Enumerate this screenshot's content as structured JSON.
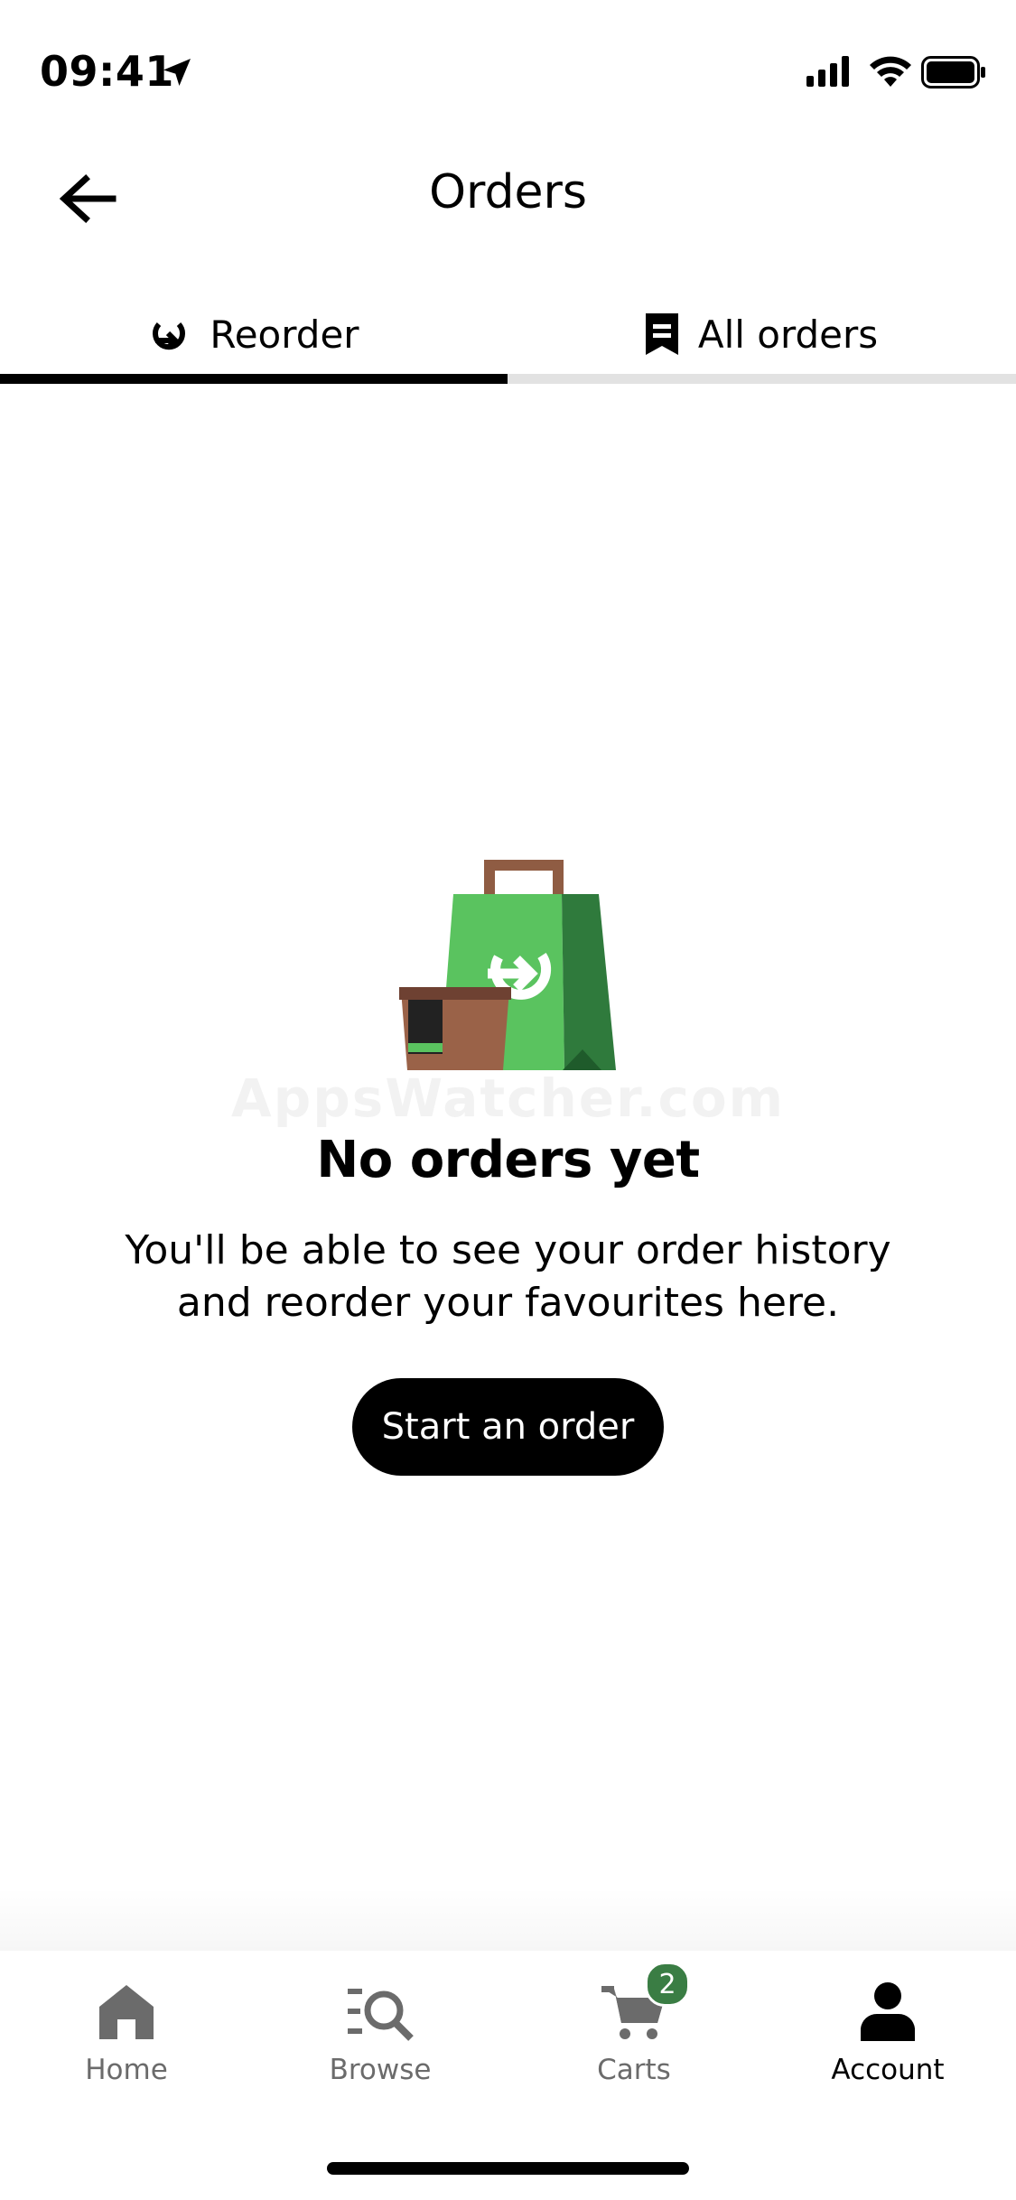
{
  "status_bar": {
    "time": "09:41"
  },
  "header": {
    "title": "Orders"
  },
  "tabs": [
    {
      "label": "Reorder",
      "active": true
    },
    {
      "label": "All orders",
      "active": false
    }
  ],
  "empty_state": {
    "watermark": "AppsWatcher.com",
    "title": "No orders yet",
    "subtitle_line1": "You'll be able to see your order history",
    "subtitle_line2": "and reorder your favourites here.",
    "cta_label": "Start an order"
  },
  "bottom_nav": {
    "items": [
      {
        "label": "Home",
        "icon": "home-icon"
      },
      {
        "label": "Browse",
        "icon": "browse-search-icon"
      },
      {
        "label": "Carts",
        "icon": "cart-icon",
        "badge": "2"
      },
      {
        "label": "Account",
        "icon": "person-icon",
        "active": true
      }
    ]
  },
  "colors": {
    "accent_green": "#5ac35f",
    "dark_green": "#2f7a3c",
    "badge_green": "#3a7d44",
    "brown": "#8f5c43",
    "inactive_gray": "#6b6b6b"
  }
}
